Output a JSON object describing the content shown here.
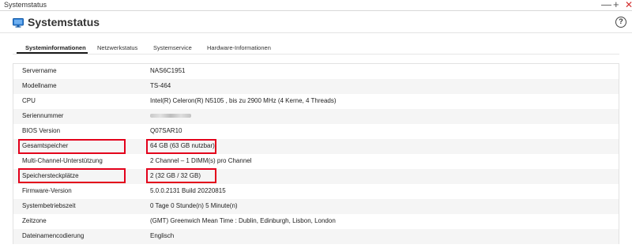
{
  "window": {
    "title": "Systemstatus",
    "controls": {
      "minimize": "—",
      "maximize": "+",
      "close": "✕"
    }
  },
  "header": {
    "icon": "monitor-icon",
    "title": "Systemstatus",
    "help": "?"
  },
  "tabs": [
    {
      "label": "Systeminformationen",
      "active": true
    },
    {
      "label": "Netzwerkstatus",
      "active": false
    },
    {
      "label": "Systemservice",
      "active": false
    },
    {
      "label": "Hardware-Informationen",
      "active": false
    }
  ],
  "info_rows": [
    {
      "label": "Servername",
      "value": "NAS6C1951"
    },
    {
      "label": "Modellname",
      "value": "TS-464"
    },
    {
      "label": "CPU",
      "value": "Intel(R) Celeron(R) N5105 , bis zu 2900 MHz (4 Kerne, 4 Threads)"
    },
    {
      "label": "Seriennummer",
      "value": ""
    },
    {
      "label": "BIOS Version",
      "value": "Q07SAR10"
    },
    {
      "label": "Gesamtspeicher",
      "value": "64 GB (63 GB nutzbar)"
    },
    {
      "label": "Multi-Channel-Unterstützung",
      "value": "2 Channel – 1 DIMM(s) pro Channel"
    },
    {
      "label": "Speichersteckplätze",
      "value": "2 (32 GB / 32 GB)"
    },
    {
      "label": "Firmware-Version",
      "value": "5.0.0.2131 Build 20220815"
    },
    {
      "label": "Systembetriebszeit",
      "value": "0 Tage 0 Stunde(n) 5 Minute(n)"
    },
    {
      "label": "Zeitzone",
      "value": "(GMT) Greenwich Mean Time : Dublin, Edinburgh, Lisbon, London"
    },
    {
      "label": "Dateinamencodierung",
      "value": "Englisch"
    }
  ],
  "colors": {
    "highlight": "#e3001b",
    "row_alt": "#f5f5f5",
    "accent_icon": "#2f7fd6"
  }
}
